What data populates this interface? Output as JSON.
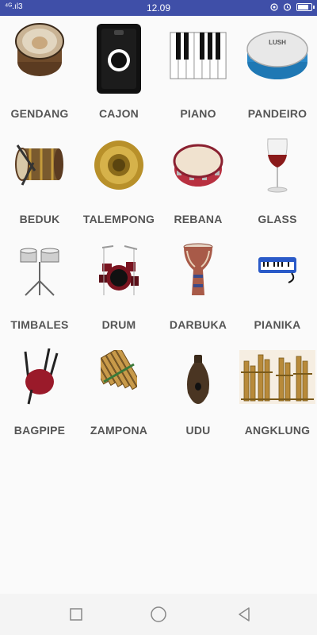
{
  "status": {
    "signal": "⁴ᴳ.ıl3",
    "time": "12.09"
  },
  "instruments": [
    {
      "label": "GENDANG"
    },
    {
      "label": "CAJON"
    },
    {
      "label": "PIANO"
    },
    {
      "label": "PANDEIRO"
    },
    {
      "label": "BEDUK"
    },
    {
      "label": "TALEMPONG"
    },
    {
      "label": "REBANA"
    },
    {
      "label": "GLASS"
    },
    {
      "label": "TIMBALES"
    },
    {
      "label": "DRUM"
    },
    {
      "label": "DARBUKA"
    },
    {
      "label": "PIANIKA"
    },
    {
      "label": "BAGPIPE"
    },
    {
      "label": "ZAMPONA"
    },
    {
      "label": "UDU"
    },
    {
      "label": "ANGKLUNG"
    }
  ],
  "pandeiro_brand": "LUSH",
  "colors": {
    "statusbar": "#3f4fa8",
    "label": "#555555",
    "background": "#fafafa"
  },
  "nav": {
    "icons": [
      "square-recent-icon",
      "circle-home-icon",
      "triangle-back-icon"
    ]
  }
}
